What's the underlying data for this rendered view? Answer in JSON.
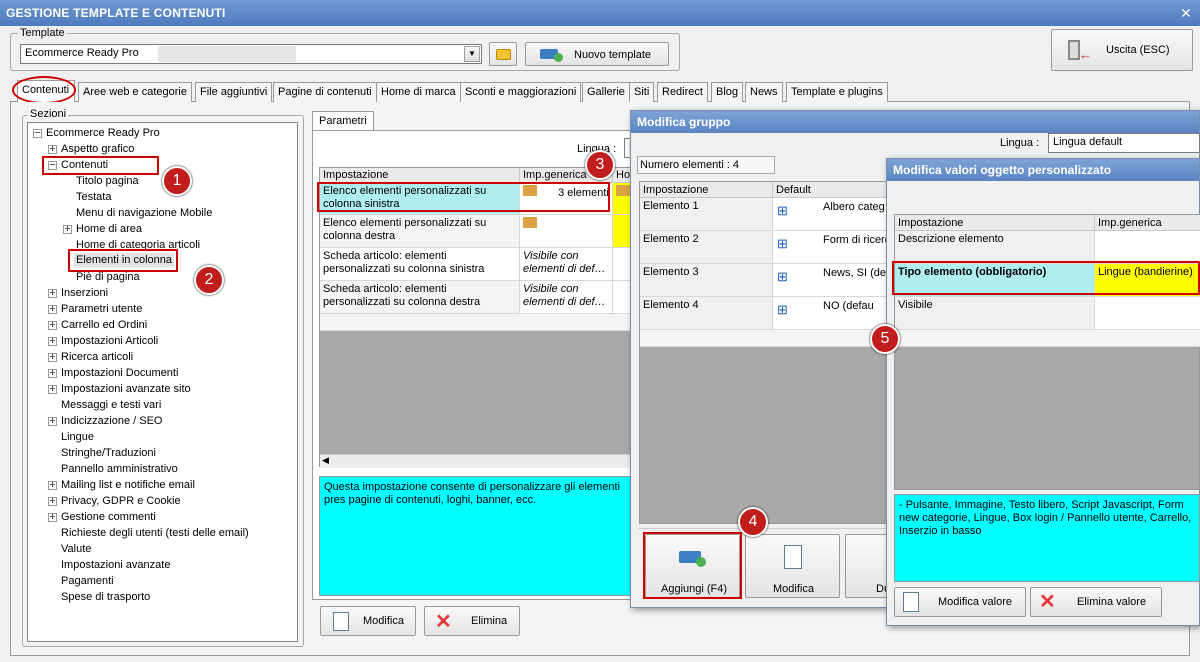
{
  "window": {
    "title": "GESTIONE TEMPLATE E CONTENUTI",
    "close": "✕"
  },
  "template": {
    "label": "Template",
    "value": "Ecommerce Ready Pro",
    "new_btn": "Nuovo template"
  },
  "exit_btn": "Uscita (ESC)",
  "tabs": [
    "Contenuti",
    "Aree web e categorie",
    "File aggiuntivi",
    "Pagine di contenuti",
    "Home di marca",
    "Sconti e maggiorazioni",
    "Gallerie",
    "Siti",
    "Redirect",
    "Blog",
    "News",
    "Template e plugins"
  ],
  "sections": {
    "label": "Sezioni",
    "items": [
      "Ecommerce Ready Pro",
      "Aspetto grafico",
      "Contenuti",
      "Titolo pagina",
      "Testata",
      "Menu di navigazione Mobile",
      "Home di area",
      "Home di categoria articoli",
      "Elementi in colonna",
      "Piè di pagina",
      "Inserzioni",
      "Parametri utente",
      "Carrello ed Ordini",
      "Impostazioni Articoli",
      "Ricerca articoli",
      "Impostazioni Documenti",
      "Impostazioni avanzate sito",
      "Messaggi e testi vari",
      "Indicizzazione / SEO",
      "Lingue",
      "Stringhe/Traduzioni",
      "Pannello amministrativo",
      "Mailing list e notifiche email",
      "Privacy, GDPR e Cookie",
      "Gestione commenti",
      "Richieste degli utenti (testi delle email)",
      "Valute",
      "Impostazioni avanzate",
      "Pagamenti",
      "Spese di trasporto"
    ]
  },
  "parametri": {
    "tab": "Parametri",
    "lingua_label": "Lingua :",
    "lingua_value": "L",
    "headers": [
      "Impostazione",
      "Imp.generica",
      "Hom"
    ],
    "rows": [
      {
        "name": "Elenco elementi personalizzati su colonna sinistra",
        "value": "3 elementi"
      },
      {
        "name": "Elenco elementi personalizzati su colonna destra",
        "value": ""
      },
      {
        "name": "Scheda articolo: elementi personalizzati su colonna sinistra",
        "value": "Visibile con elementi di def…"
      },
      {
        "name": "Scheda articolo: elementi personalizzati su colonna destra",
        "value": "Visibile con elementi di def…"
      }
    ],
    "description": "Questa impostazione consente di personalizzare gli elementi pres pagine di contenuti, loghi, banner, ecc.",
    "btn_modifica": "Modifica",
    "btn_elimina": "Elimina"
  },
  "gruppo": {
    "title": "Modifica gruppo",
    "lingua_label": "Lingua :",
    "lingua_value": "Lingua default",
    "count": "Numero elementi : 4",
    "headers": [
      "Impostazione",
      "Default"
    ],
    "rows": [
      {
        "name": "Elemento 1",
        "value": "Albero categ"
      },
      {
        "name": "Elemento 2",
        "value": "Form di ricerc"
      },
      {
        "name": "Elemento 3",
        "value": "News, SI (de"
      },
      {
        "name": "Elemento 4",
        "value": "NO (defau"
      }
    ],
    "btn_aggiungi": "Aggiungi (F4)",
    "btn_modifica": "Modifica",
    "btn_du": "Du"
  },
  "valori": {
    "title": "Modifica valori oggetto personalizzato",
    "headers": [
      "Impostazione",
      "Imp.generica"
    ],
    "rows": [
      {
        "name": "Descrizione elemento",
        "value": ""
      },
      {
        "name": "Tipo elemento (obbligatorio)",
        "value": "Lingue (bandierine)"
      },
      {
        "name": "Visibile",
        "value": ""
      }
    ],
    "description": "- Pulsante, Immagine, Testo libero, Script Javascript, Form new categorie, Lingue, Box login / Pannello utente, Carrello, Inserzio in basso",
    "btn_modifica": "Modifica valore",
    "btn_elimina": "Elimina valore"
  },
  "badges": [
    "1",
    "2",
    "3",
    "4",
    "5"
  ],
  "colors": {
    "accent_red": "#d00000",
    "cyan": "#00ffff",
    "yellow": "#ffff00",
    "selected": "#aeeef0"
  }
}
